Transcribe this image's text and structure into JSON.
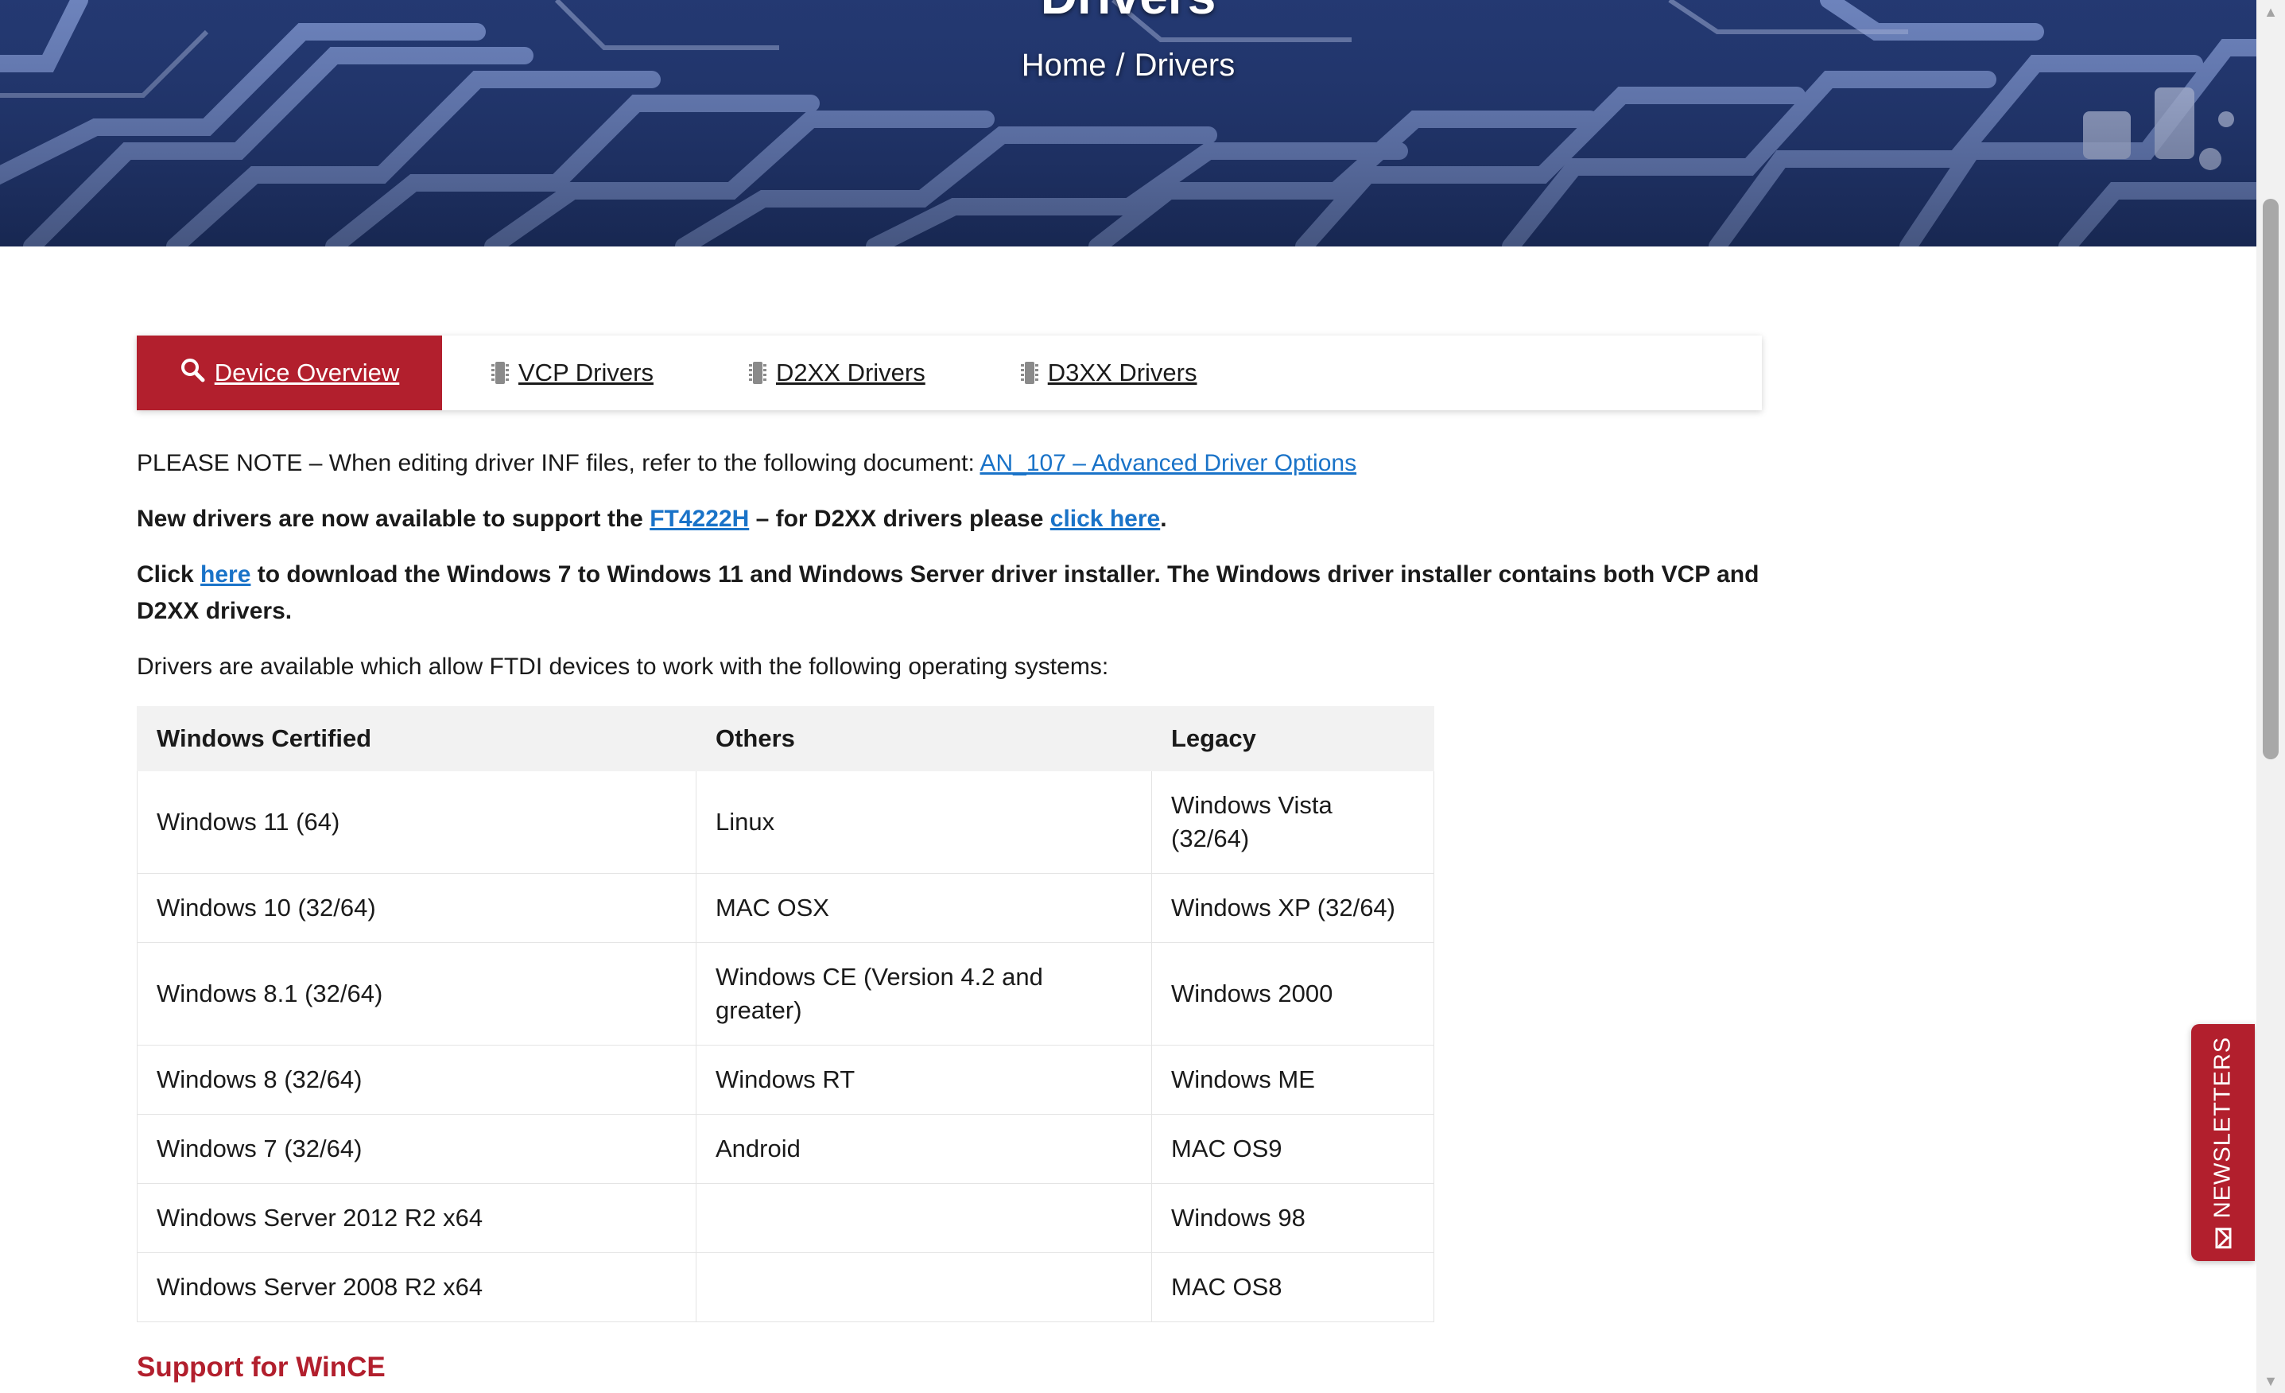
{
  "hero": {
    "title": "Drivers",
    "breadcrumb": {
      "home": "Home",
      "separator": "/",
      "current": "Drivers"
    }
  },
  "tabs": [
    {
      "label": "Device Overview",
      "icon": "search-icon",
      "active": true
    },
    {
      "label": "VCP Drivers",
      "icon": "chip-icon",
      "active": false
    },
    {
      "label": "D2XX Drivers",
      "icon": "chip-icon",
      "active": false
    },
    {
      "label": "D3XX Drivers",
      "icon": "chip-icon",
      "active": false
    }
  ],
  "content": {
    "note_prefix": "PLEASE NOTE – When editing driver INF files, refer to the following document: ",
    "note_link": "AN_107 – Advanced Driver Options",
    "new_drivers_prefix": "New drivers are now available to support the ",
    "new_drivers_link": "FT4222H",
    "new_drivers_middle": " – for D2XX drivers please ",
    "new_drivers_link2": "click here",
    "new_drivers_suffix": ".",
    "installer_prefix": "Click ",
    "installer_link": "here",
    "installer_suffix": " to download the Windows 7 to Windows 11 and Windows Server driver installer. The Windows driver installer contains both VCP and D2XX drivers.",
    "available": "Drivers are available which allow FTDI devices to work with the following operating systems:"
  },
  "table": {
    "headers": [
      "Windows Certified",
      "Others",
      "Legacy"
    ],
    "rows": [
      [
        "Windows 11 (64)",
        "Linux",
        "Windows Vista (32/64)"
      ],
      [
        "Windows 10 (32/64)",
        "MAC OSX",
        "Windows XP (32/64)"
      ],
      [
        "Windows 8.1 (32/64)",
        "Windows CE (Version 4.2 and greater)",
        "Windows 2000"
      ],
      [
        "Windows 8 (32/64)",
        "Windows RT",
        "Windows ME"
      ],
      [
        "Windows 7 (32/64)",
        "Android",
        "MAC OS9"
      ],
      [
        "Windows Server 2012 R2 x64",
        "",
        "Windows 98"
      ],
      [
        "Windows Server 2008 R2 x64",
        "",
        "MAC OS8"
      ]
    ]
  },
  "support_heading": "Support for WinCE",
  "newsletters": {
    "label": "NEWSLETTERS",
    "icon": "mail-icon"
  },
  "colors": {
    "accent": "#b21f2d",
    "link": "#1a73c8",
    "table_header_bg": "#f2f2f2"
  }
}
